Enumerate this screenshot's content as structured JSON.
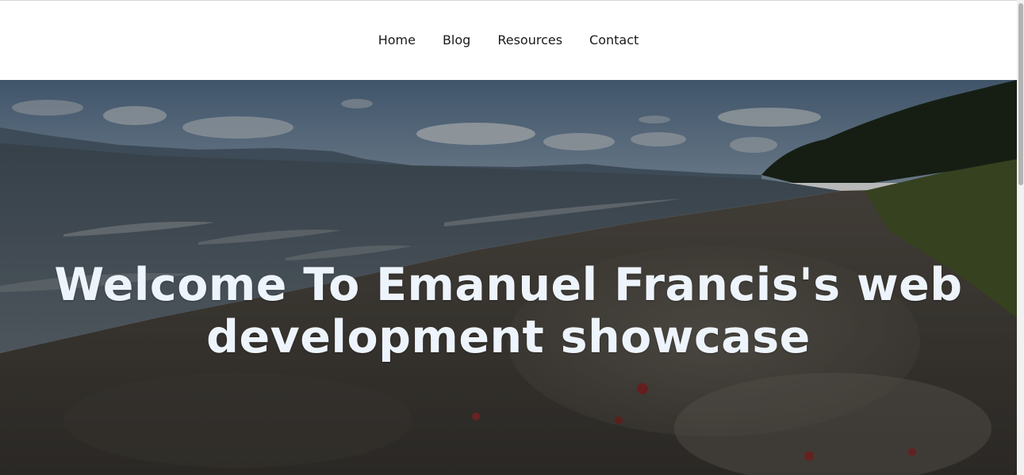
{
  "nav": {
    "items": [
      {
        "label": "Home"
      },
      {
        "label": "Blog"
      },
      {
        "label": "Resources"
      },
      {
        "label": "Contact"
      }
    ]
  },
  "hero": {
    "title_line1": "Welcome To Emanuel Francis's web",
    "title_line2": "development showcase",
    "background": "beach-shoreline-photo",
    "title_color": "#eef4fb"
  }
}
